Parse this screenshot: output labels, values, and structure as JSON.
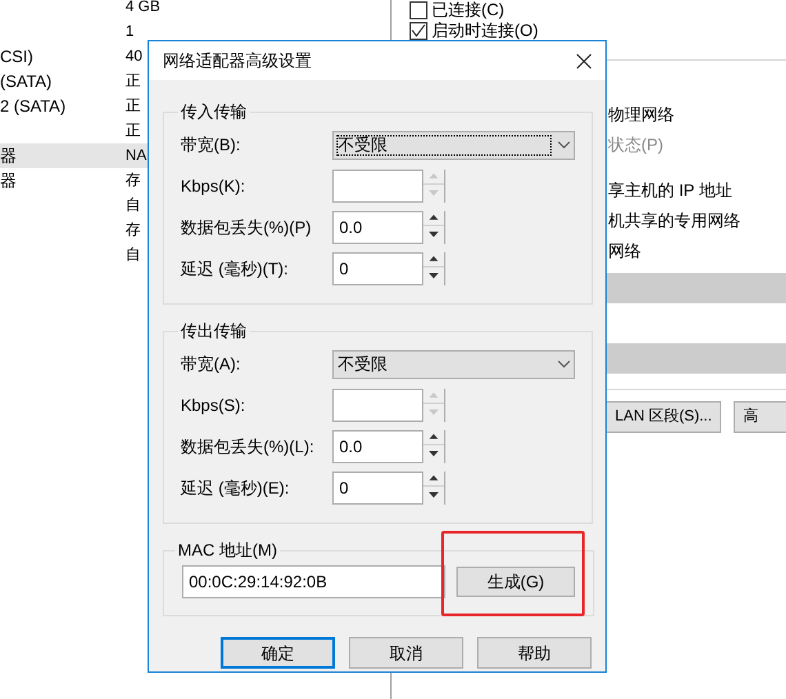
{
  "device_list": {
    "rows": [
      {
        "summary": "4 GB",
        "selected": false
      },
      {
        "summary": "1",
        "selected": false
      },
      {
        "name": "CSI)",
        "summary": "40",
        "selected": false
      },
      {
        "name": "(SATA)",
        "summary": "正",
        "selected": false
      },
      {
        "name": "2 (SATA)",
        "summary": "正",
        "selected": false
      },
      {
        "summary": "正",
        "selected": false
      },
      {
        "name": "器",
        "summary": "NA",
        "selected": true
      },
      {
        "name": "器",
        "summary": "存",
        "selected": false
      },
      {
        "summary": "自",
        "selected": false
      },
      {
        "summary": "存",
        "selected": false
      },
      {
        "summary": "自",
        "selected": false
      }
    ]
  },
  "right_panel": {
    "checkboxes": [
      {
        "label": "已连接(C)",
        "checked": false
      },
      {
        "label": "启动时连接(O)",
        "checked": true
      }
    ],
    "options": [
      {
        "label": "物理网络",
        "disabled": false
      },
      {
        "label": "状态(P)",
        "disabled": true
      },
      {
        "label": "享主机的 IP 地址",
        "disabled": false
      },
      {
        "label": "机共享的专用网络",
        "disabled": false
      },
      {
        "label": "网络",
        "disabled": false
      }
    ],
    "buttons": [
      "LAN 区段(S)...",
      "高"
    ]
  },
  "dialog": {
    "title": "网络适配器高级设置",
    "groups": [
      {
        "title": "传入传输",
        "rows": [
          {
            "kind": "select",
            "label": "带宽(B):",
            "value": "不受限",
            "focused": true
          },
          {
            "kind": "spin",
            "label": "Kbps(K):",
            "disabled": true
          },
          {
            "kind": "spin",
            "label": "数据包丢失(%)(P)",
            "value": "0.0",
            "disabled": false
          },
          {
            "kind": "spin",
            "label": "延迟 (毫秒)(T):",
            "value": "0",
            "disabled": false
          }
        ]
      },
      {
        "title": "传出传输",
        "rows": [
          {
            "kind": "select",
            "label": "带宽(A):",
            "value": "不受限",
            "focused": false
          },
          {
            "kind": "spin",
            "label": "Kbps(S):",
            "disabled": true
          },
          {
            "kind": "spin",
            "label": "数据包丢失(%)(L):",
            "value": "0.0",
            "disabled": false
          },
          {
            "kind": "spin",
            "label": "延迟 (毫秒)(E):",
            "value": "0",
            "disabled": false
          }
        ]
      }
    ],
    "mac": {
      "title": "MAC 地址(M)",
      "value": "00:0C:29:14:92:0B",
      "button": "生成(G)",
      "highlighted": true
    },
    "buttons": [
      {
        "label": "确定",
        "focused": true
      },
      {
        "label": "取消",
        "focused": false
      },
      {
        "label": "帮助",
        "focused": false
      }
    ]
  }
}
